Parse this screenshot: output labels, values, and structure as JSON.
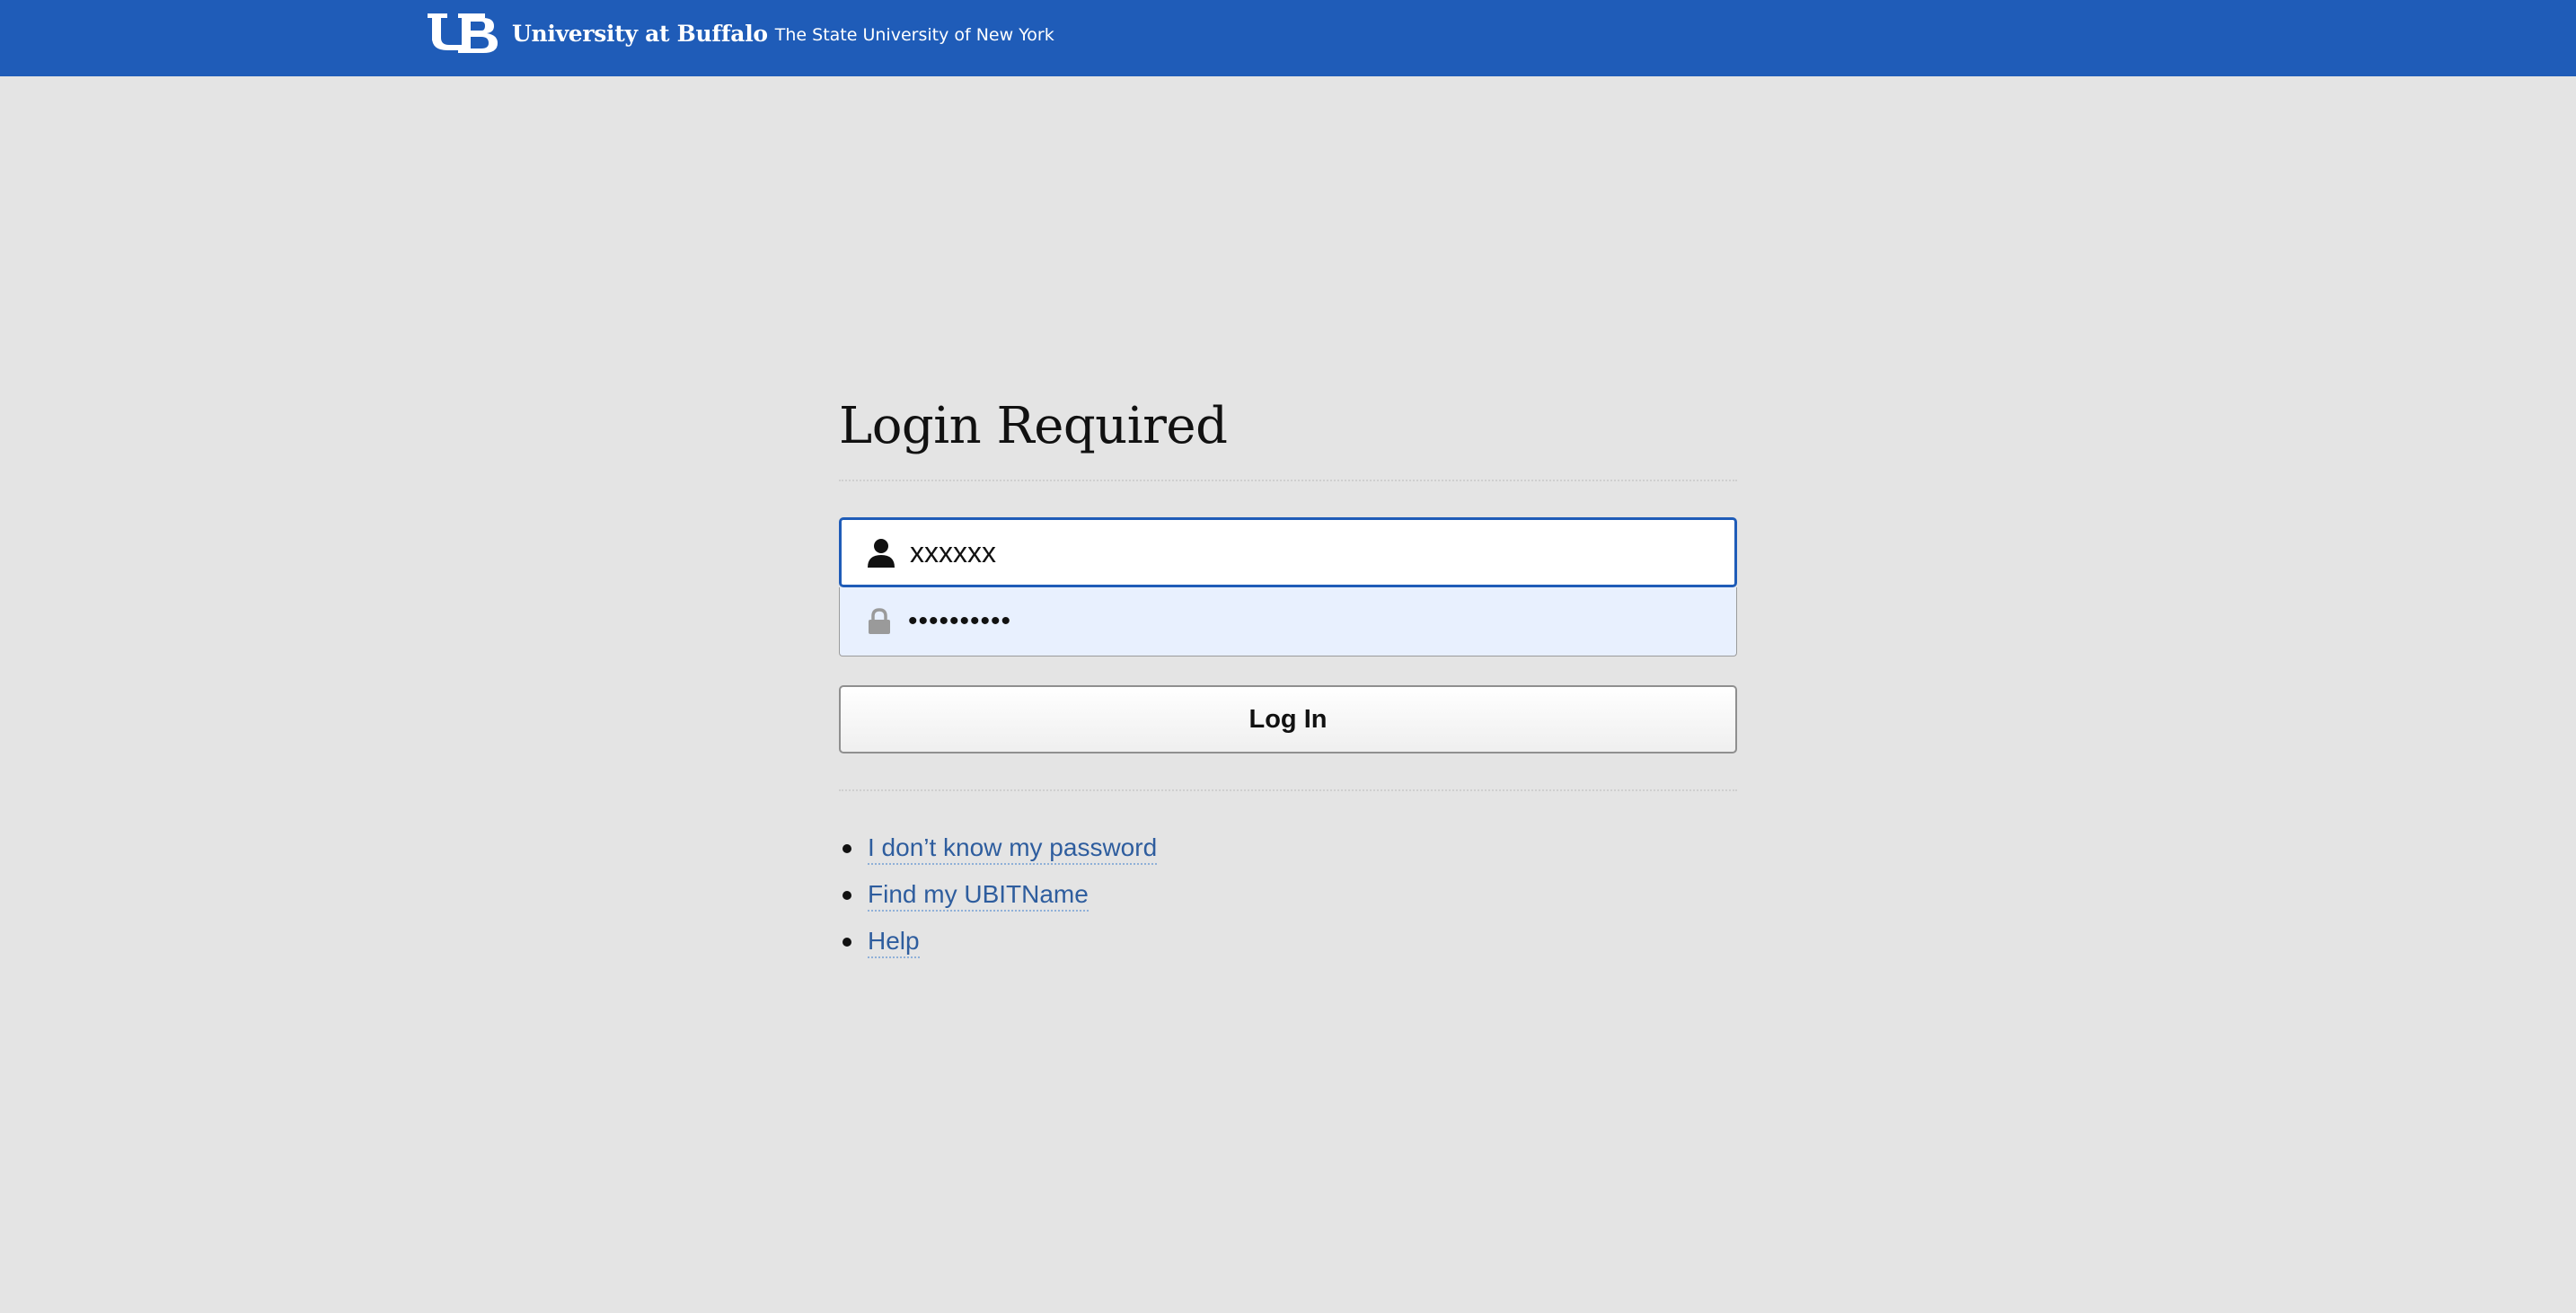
{
  "header": {
    "brand_name": "University at Buffalo",
    "brand_sub": "The State University of New York",
    "background_color": "#1f5cb8"
  },
  "login": {
    "title": "Login Required",
    "username": {
      "icon": "user-icon",
      "value": "xxxxxx"
    },
    "password": {
      "icon": "lock-icon",
      "value": "••••••••••"
    },
    "submit_label": "Log In"
  },
  "links": [
    {
      "label": "I don’t know my password"
    },
    {
      "label": "Find my UBITName"
    },
    {
      "label": "Help"
    }
  ]
}
